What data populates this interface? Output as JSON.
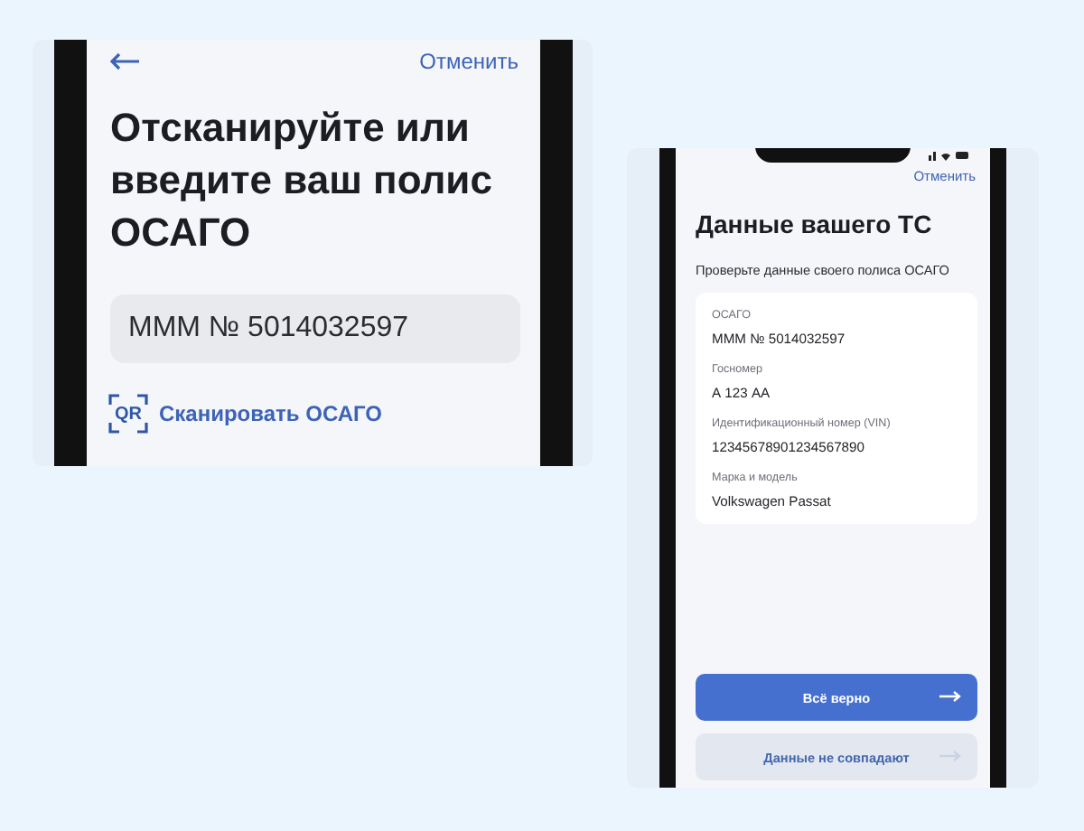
{
  "scan_screen": {
    "cancel": "Отменить",
    "title": "Отсканируйте или введите ваш полис ОСАГО",
    "policy_field": {
      "value": "МММ № 5014032597"
    },
    "scan_link": {
      "qr": "QR",
      "label": "Сканировать ОСАГО"
    }
  },
  "vehicle_screen": {
    "cancel": "Отменить",
    "title": "Данные вашего ТС",
    "subtitle": "Проверьте данные своего полиса ОСАГО",
    "fields": [
      {
        "label": "ОСАГО",
        "value": "МММ № 5014032597"
      },
      {
        "label": "Госномер",
        "value": "А 123 АА"
      },
      {
        "label": "Идентификационный номер (VIN)",
        "value": "12345678901234567890"
      },
      {
        "label": "Марка и модель",
        "value": "Volkswagen Passat"
      }
    ],
    "buttons": [
      {
        "label": "Всё верно",
        "kind": "primary"
      },
      {
        "label": "Данные не совпадают",
        "kind": "secondary"
      }
    ]
  }
}
